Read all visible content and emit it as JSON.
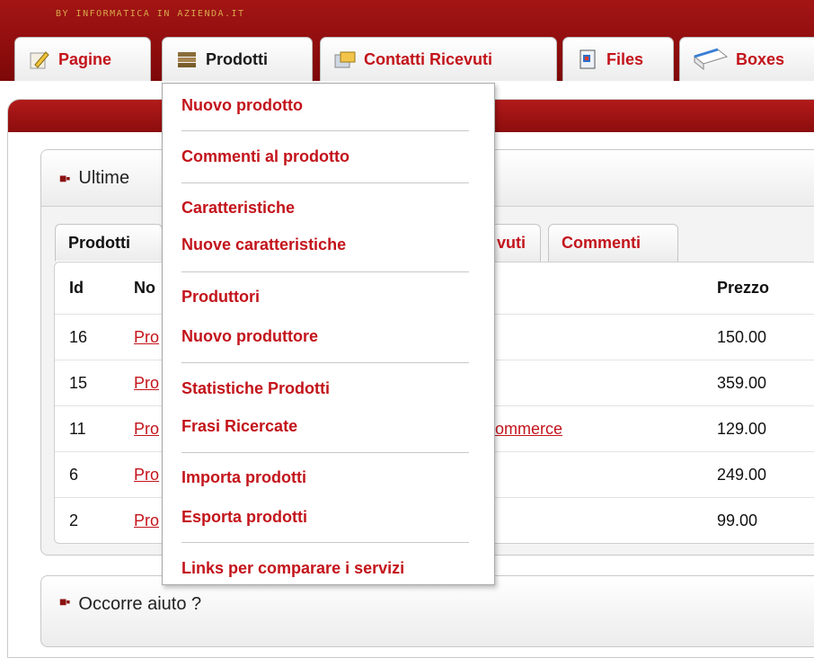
{
  "header": {
    "brand": "BY INFORMATICA IN AZIENDA.IT"
  },
  "tabs": [
    {
      "label": "Pagine",
      "icon": "pencil-icon"
    },
    {
      "label": "Prodotti",
      "icon": "stack-icon"
    },
    {
      "label": "Contatti Ricevuti",
      "icon": "contacts-icon"
    },
    {
      "label": "Files",
      "icon": "file-icon"
    },
    {
      "label": "Boxes",
      "icon": "box-icon"
    }
  ],
  "box1": {
    "title": "Ultime",
    "subtabs": [
      "Prodotti",
      "vuti",
      "Commenti"
    ],
    "table": {
      "headers": {
        "id": "Id",
        "name": "No",
        "price": "Prezzo"
      },
      "rows": [
        {
          "id": "16",
          "name": "Pro",
          "price": "150.00"
        },
        {
          "id": "15",
          "name": "Pro",
          "price": "359.00"
        },
        {
          "id": "11",
          "name": "Pro",
          "price": "129.00",
          "extra": "ommerce"
        },
        {
          "id": "6",
          "name": "Pro",
          "price": "249.00"
        },
        {
          "id": "2",
          "name": "Pro",
          "price": "99.00"
        }
      ]
    }
  },
  "box2": {
    "title": "Occorre aiuto ?"
  },
  "dropdown": {
    "items": [
      "Nuovo prodotto",
      "Commenti al prodotto",
      "Caratteristiche",
      "Nuove caratteristiche",
      "Produttori",
      "Nuovo produttore",
      "Statistiche Prodotti",
      "Frasi Ricercate",
      "Importa prodotti",
      "Esporta prodotti",
      "Links per comparare i servizi"
    ]
  },
  "colors": {
    "brand": "#8f0d0d",
    "accent": "#c3141b"
  }
}
